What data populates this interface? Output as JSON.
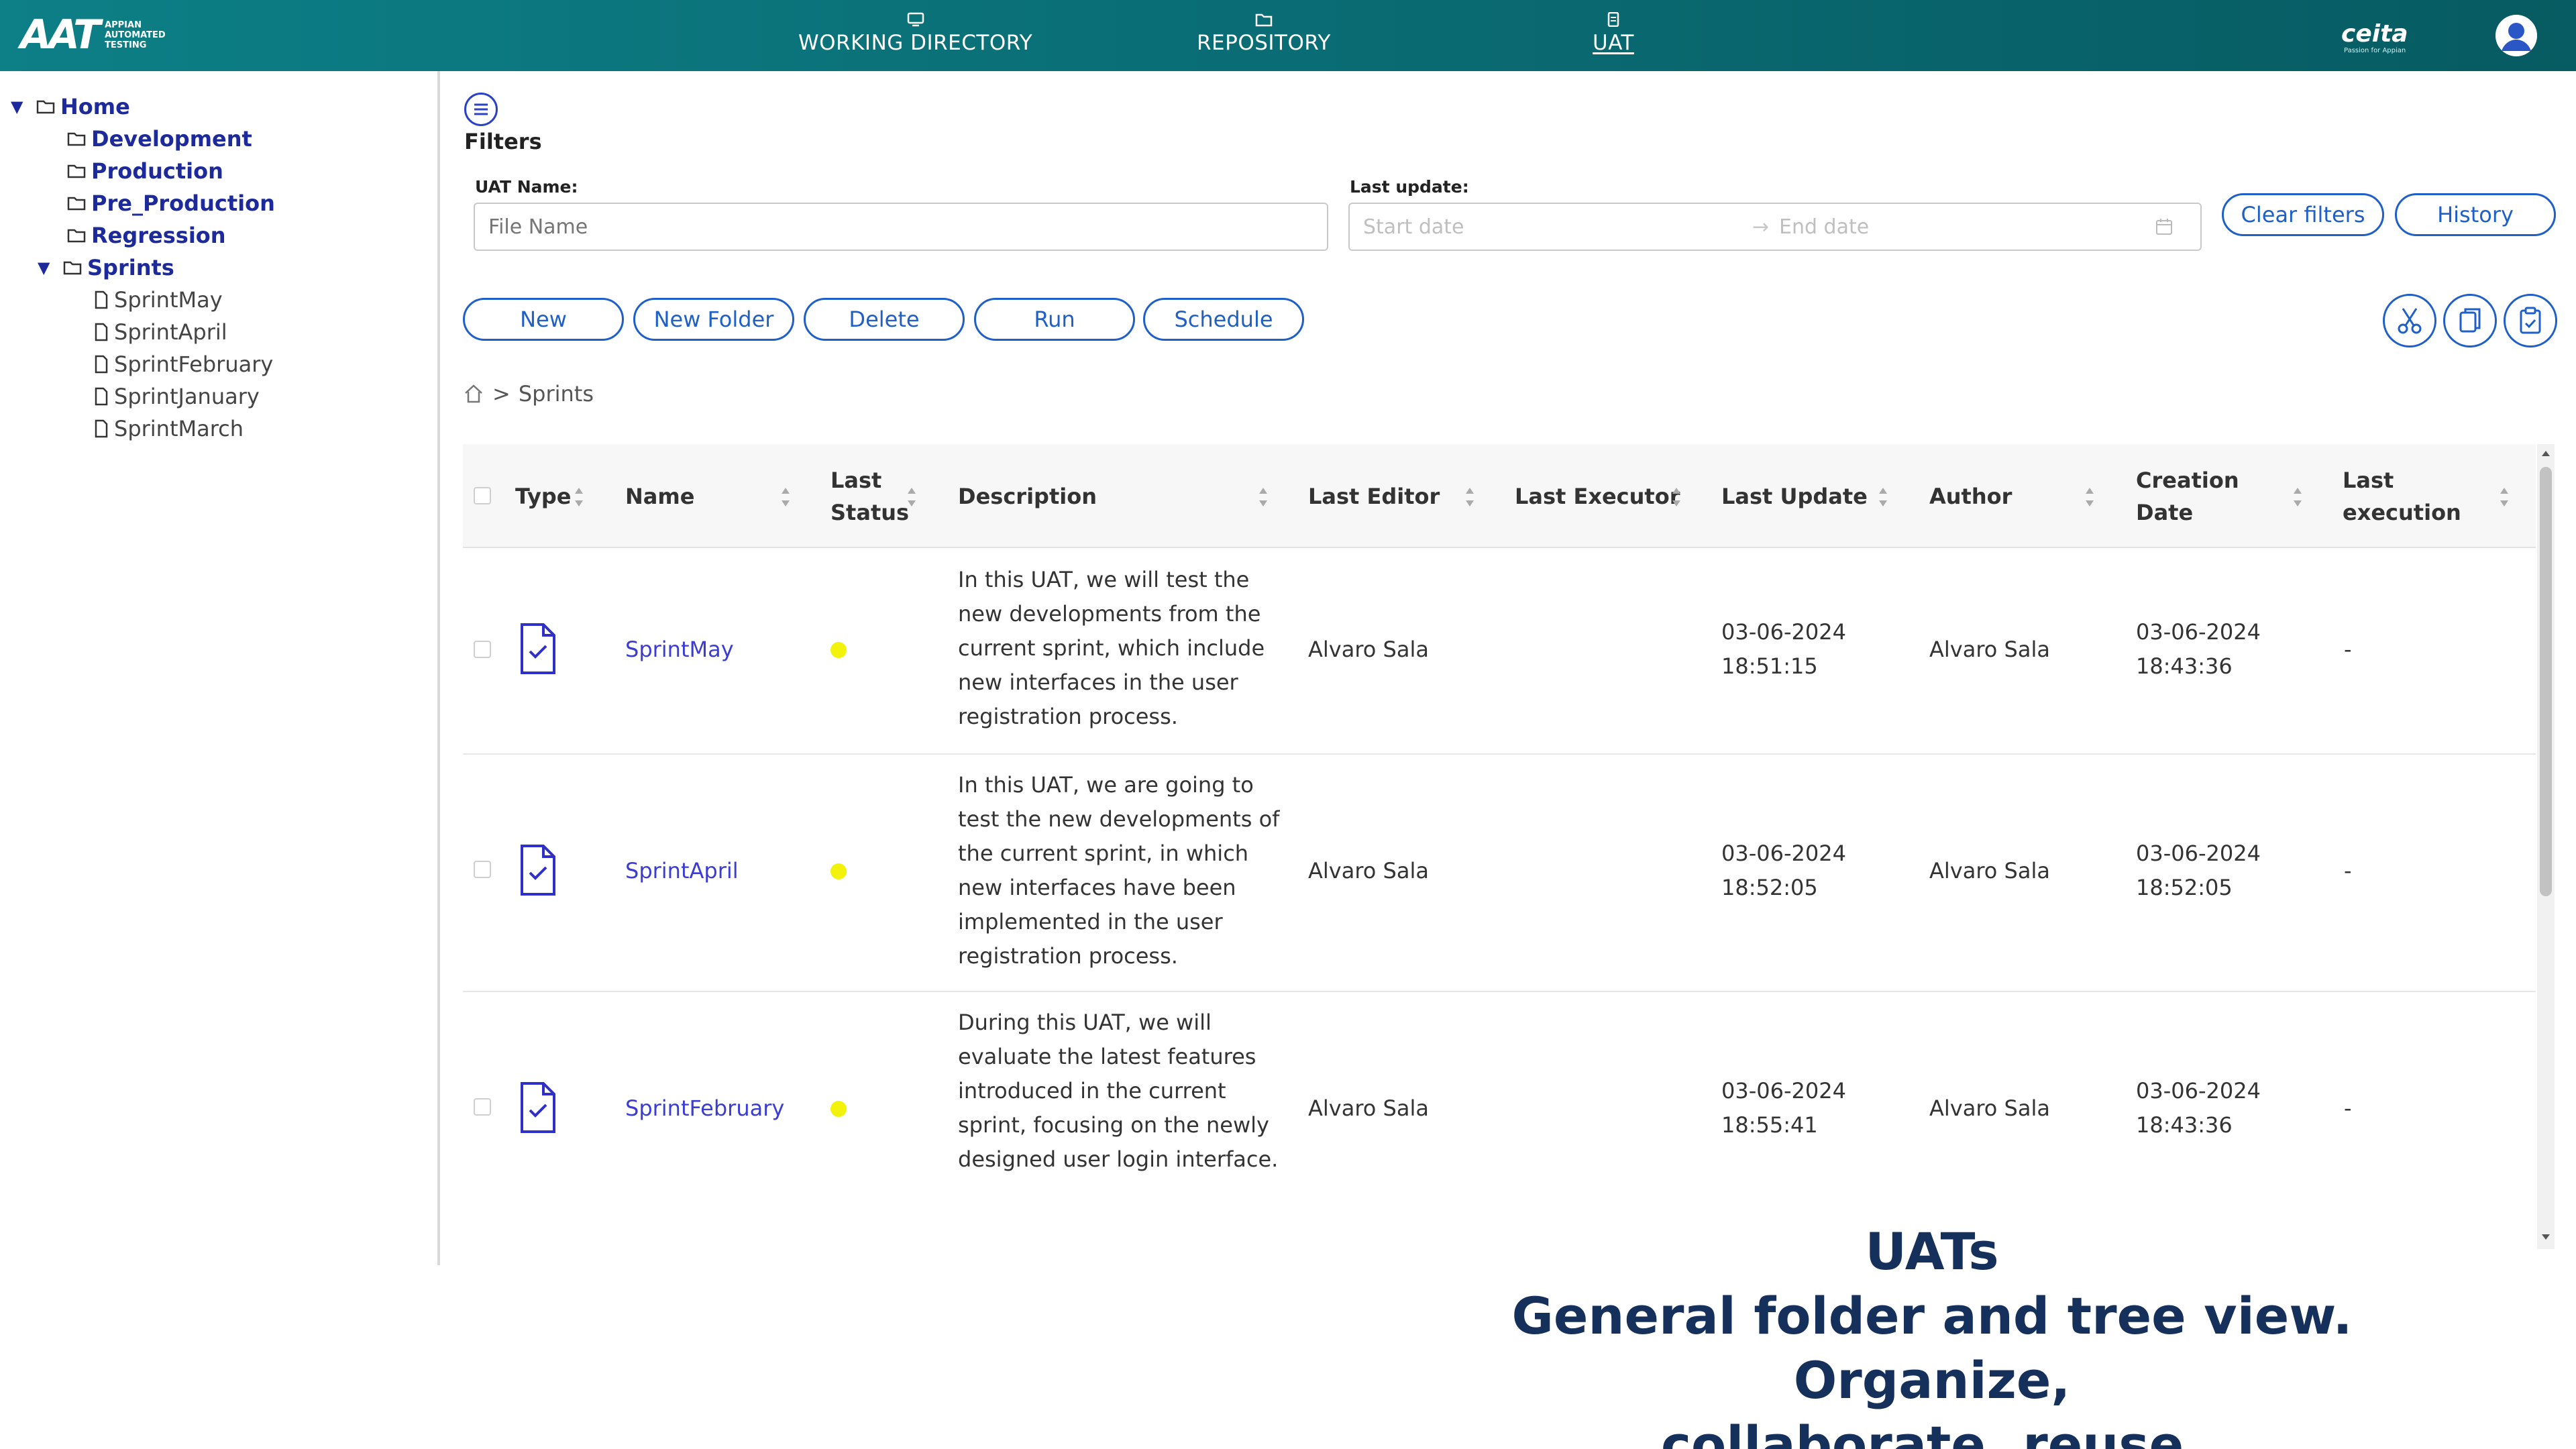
{
  "header": {
    "logo_mark": "AAT",
    "logo_sub": [
      "APPIAN",
      "AUTOMATED",
      "TESTING"
    ],
    "nav": [
      {
        "label": "WORKING DIRECTORY"
      },
      {
        "label": "REPOSITORY"
      },
      {
        "label": "UAT",
        "active": true
      }
    ],
    "brand": "ceita",
    "brand_sub": "Passion for Appian"
  },
  "sidebar": {
    "root": "Home",
    "folders": [
      "Development",
      "Production",
      "Pre_Production",
      "Regression"
    ],
    "expanded_folder": "Sprints",
    "files": [
      "SprintMay",
      "SprintApril",
      "SprintFebruary",
      "SprintJanuary",
      "SprintMarch"
    ]
  },
  "filters": {
    "title": "Filters",
    "uat_name_label": "UAT Name:",
    "uat_name_placeholder": "File Name",
    "last_update_label": "Last update:",
    "start_placeholder": "Start date",
    "end_placeholder": "End date",
    "clear_label": "Clear filters",
    "history_label": "History"
  },
  "toolbar": {
    "new_label": "New",
    "new_folder_label": "New Folder",
    "delete_label": "Delete",
    "run_label": "Run",
    "schedule_label": "Schedule"
  },
  "breadcrumb": {
    "separator": ">",
    "current": "Sprints"
  },
  "table": {
    "columns": [
      "Type",
      "Name",
      "Last Status",
      "Description",
      "Last Editor",
      "Last Executor",
      "Last Update",
      "Author",
      "Creation Date",
      "Last execution"
    ],
    "rows": [
      {
        "name": "SprintMay",
        "status_color": "#f2f20a",
        "description": "In this UAT, we will test the new developments from the current sprint, which include new interfaces in the user registration process.",
        "last_editor": "Alvaro Sala",
        "last_executor": "",
        "last_update_date": "03-06-2024",
        "last_update_time": "18:51:15",
        "author": "Alvaro Sala",
        "creation_date": "03-06-2024",
        "creation_time": "18:43:36",
        "last_execution": "-"
      },
      {
        "name": "SprintApril",
        "status_color": "#f2f20a",
        "description": "In this UAT, we are going to test the new developments of the current sprint, in which new interfaces have been implemented in the user registration process.",
        "last_editor": "Alvaro Sala",
        "last_executor": "",
        "last_update_date": "03-06-2024",
        "last_update_time": "18:52:05",
        "author": "Alvaro Sala",
        "creation_date": "03-06-2024",
        "creation_time": "18:52:05",
        "last_execution": "-"
      },
      {
        "name": "SprintFebruary",
        "status_color": "#f2f20a",
        "description": "During this UAT, we will evaluate the latest features introduced in the current sprint, focusing on the newly designed user login interface.",
        "last_editor": "Alvaro Sala",
        "last_executor": "",
        "last_update_date": "03-06-2024",
        "last_update_time": "18:55:41",
        "author": "Alvaro Sala",
        "creation_date": "03-06-2024",
        "creation_time": "18:43:36",
        "last_execution": "-"
      }
    ]
  },
  "caption": {
    "line1": "UATs",
    "line2": "General folder and tree view. Organize,",
    "line3": "collaborate, reuse."
  },
  "colors": {
    "header_bg": "#0a6c74",
    "accent_blue": "#1f5fc8",
    "tree_blue": "#1d2a9c",
    "link_blue": "#3b3bd6",
    "status_yellow": "#f2f20a",
    "caption": "#16305c"
  },
  "icons": {
    "toggle": "list-icon",
    "cut": "scissors-icon",
    "copy": "copy-icon",
    "paste": "clipboard-icon",
    "home": "home-icon",
    "calendar": "calendar-icon",
    "folder": "folder-icon",
    "file": "file-icon",
    "uat_file": "file-check-icon",
    "user": "user-avatar-icon"
  }
}
